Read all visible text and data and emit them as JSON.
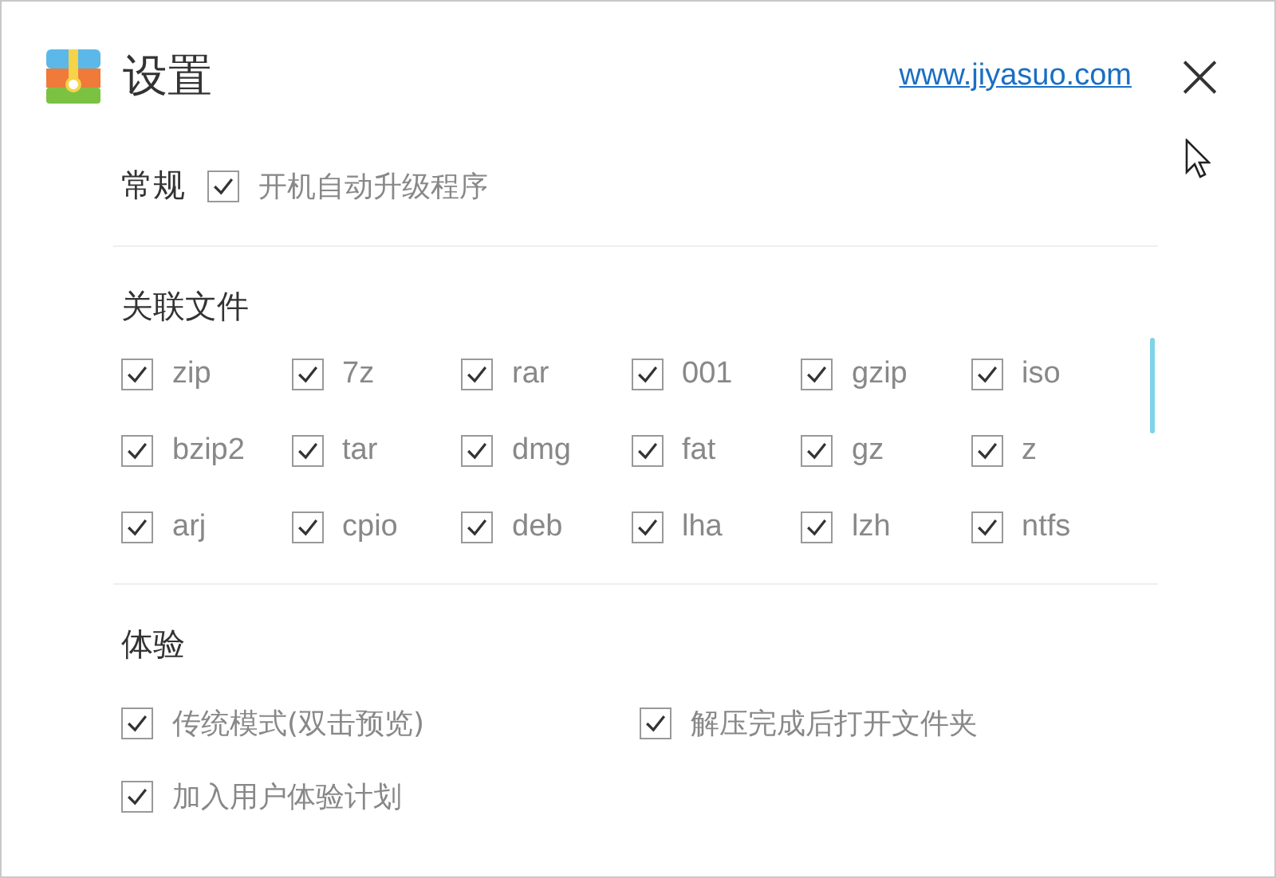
{
  "window": {
    "title": "设置",
    "link": "www.jiyasuo.com",
    "close": "×"
  },
  "general": {
    "heading": "常规",
    "options": [
      {
        "label": "开机自动升级程序",
        "checked": true
      }
    ]
  },
  "associations": {
    "heading": "关联文件",
    "items": [
      {
        "label": "zip",
        "checked": true
      },
      {
        "label": "7z",
        "checked": true
      },
      {
        "label": "rar",
        "checked": true
      },
      {
        "label": "001",
        "checked": true
      },
      {
        "label": "gzip",
        "checked": true
      },
      {
        "label": "iso",
        "checked": true
      },
      {
        "label": "bzip2",
        "checked": true
      },
      {
        "label": "tar",
        "checked": true
      },
      {
        "label": "dmg",
        "checked": true
      },
      {
        "label": "fat",
        "checked": true
      },
      {
        "label": "gz",
        "checked": true
      },
      {
        "label": "z",
        "checked": true
      },
      {
        "label": "arj",
        "checked": true
      },
      {
        "label": "cpio",
        "checked": true
      },
      {
        "label": "deb",
        "checked": true
      },
      {
        "label": "lha",
        "checked": true
      },
      {
        "label": "lzh",
        "checked": true
      },
      {
        "label": "ntfs",
        "checked": true
      }
    ]
  },
  "experience": {
    "heading": "体验",
    "options": [
      {
        "label": "传统模式(双击预览)",
        "checked": true
      },
      {
        "label": "解压完成后打开文件夹",
        "checked": true
      },
      {
        "label": "加入用户体验计划",
        "checked": true
      }
    ]
  }
}
